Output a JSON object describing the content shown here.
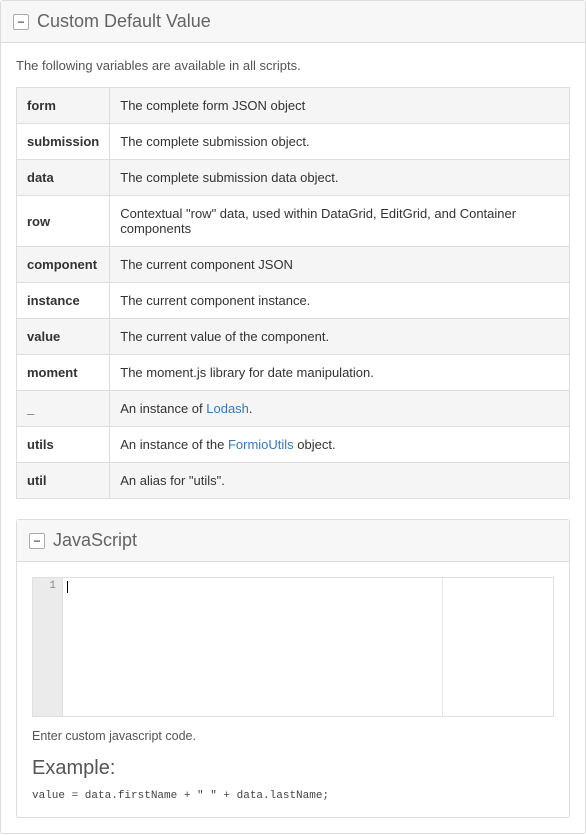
{
  "panel": {
    "title": "Custom Default Value",
    "intro": "The following variables are available in all scripts.",
    "toggle_icon": "−"
  },
  "variables": [
    {
      "name": "form",
      "desc": "The complete form JSON object"
    },
    {
      "name": "submission",
      "desc": "The complete submission object."
    },
    {
      "name": "data",
      "desc": "The complete submission data object."
    },
    {
      "name": "row",
      "desc": "Contextual \"row\" data, used within DataGrid, EditGrid, and Container components"
    },
    {
      "name": "component",
      "desc": "The current component JSON"
    },
    {
      "name": "instance",
      "desc": "The current component instance."
    },
    {
      "name": "value",
      "desc": "The current value of the component."
    },
    {
      "name": "moment",
      "desc": "The moment.js library for date manipulation."
    },
    {
      "name": "_",
      "desc_prefix": "An instance of ",
      "link": "Lodash",
      "desc_suffix": "."
    },
    {
      "name": "utils",
      "desc_prefix": "An instance of the ",
      "link": "FormioUtils",
      "desc_suffix": " object."
    },
    {
      "name": "util",
      "desc": "An alias for \"utils\"."
    }
  ],
  "js_panel": {
    "title": "JavaScript",
    "toggle_icon": "−",
    "line_number": "1",
    "helper": "Enter custom javascript code.",
    "example_heading": "Example:",
    "example_code": "value = data.firstName + \" \" + data.lastName;"
  }
}
